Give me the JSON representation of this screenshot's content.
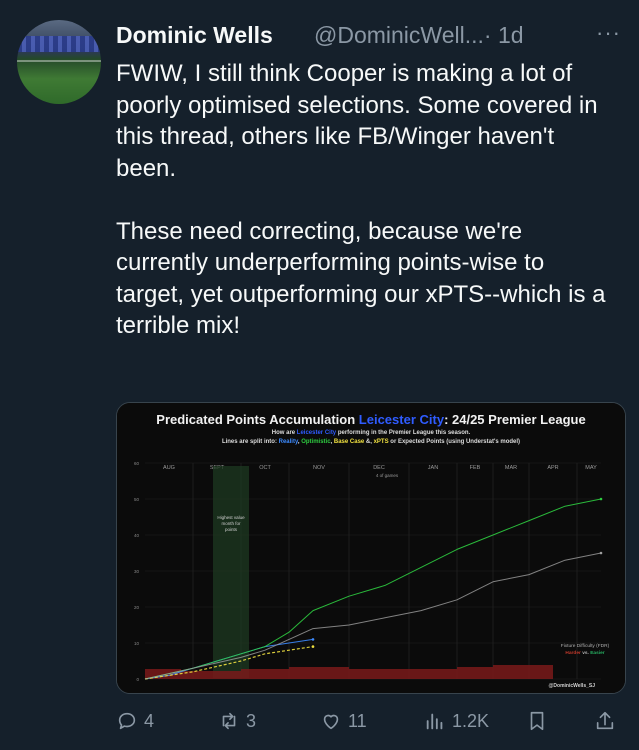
{
  "tweet": {
    "author_name": "Dominic Wells",
    "handle": "@DominicWell...",
    "time": "· 1d",
    "more": "···",
    "paragraph1": "FWIW, I still think Cooper is making a lot of poorly optimised selections. Some covered in this thread, others like FB/Winger haven't been.",
    "paragraph2": "These need correcting, because we're currently underperforming points-wise to target, yet outperforming our xPTS--which is a terrible mix!"
  },
  "chart": {
    "title_part1": "Predicated Points Accumulation ",
    "title_club": "Leicester City",
    "title_part2": ": 24/25 Premier League",
    "subtitle1_a": "How are ",
    "subtitle1_club": "Leicester City",
    "subtitle1_b": " performing in the Premier League this season.",
    "subtitle2_a": "Lines are split into: ",
    "subtitle2_reality": "Reality",
    "subtitle2_comma1": ", ",
    "subtitle2_optimistic": "Optimistic",
    "subtitle2_comma2": ", ",
    "subtitle2_base": "Base Case",
    "subtitle2_and": " &, ",
    "subtitle2_xpts": "xPTS",
    "subtitle2_end": " or Expected Points (using Understat's model)",
    "months": [
      "AUG",
      "SEPT",
      "OCT",
      "NOV",
      "DEC",
      "JAN",
      "FEB",
      "MAR",
      "APR",
      "MAY"
    ],
    "jan_note": "4 of games",
    "highlight_note": "Highest value month for points",
    "fdr_label": "Fixture Difficulty (FDR)",
    "fdr_harder": "Harder",
    "fdr_vs": " vs. ",
    "fdr_easier": "Easier",
    "credit": "@DominicWells_SJ",
    "colors": {
      "reality": "#3d8bff",
      "optimistic": "#2ecc40",
      "base": "#f0e040",
      "xpts": "#a0a0a0",
      "club": "#2f5cff",
      "harder": "#c0392b",
      "easier": "#27ae60"
    }
  },
  "chart_data": {
    "type": "line",
    "title": "Predicated Points Accumulation Leicester City: 24/25 Premier League",
    "xlabel": "",
    "ylabel": "",
    "ylim": [
      0,
      60
    ],
    "yticks": [
      0,
      10,
      20,
      30,
      40,
      50,
      60
    ],
    "x_categories": [
      "AUG",
      "SEPT",
      "OCT",
      "NOV",
      "DEC",
      "JAN",
      "FEB",
      "MAR",
      "APR",
      "MAY"
    ],
    "x_range": [
      0,
      38
    ],
    "series": [
      {
        "name": "Reality",
        "color": "#3d8bff",
        "x": [
          0,
          2,
          4,
          6,
          8,
          10,
          12,
          14
        ],
        "y": [
          0,
          1,
          3,
          5,
          7,
          9,
          10,
          11
        ]
      },
      {
        "name": "Optimistic",
        "color": "#2ecc40",
        "x": [
          0,
          4,
          8,
          10,
          12,
          14,
          17,
          20,
          23,
          26,
          29,
          32,
          35,
          38
        ],
        "y": [
          0,
          3,
          7,
          9,
          13,
          19,
          23,
          26,
          31,
          36,
          40,
          44,
          48,
          50
        ]
      },
      {
        "name": "Base Case",
        "color": "#f0e040",
        "x": [
          0,
          4,
          8,
          10,
          12,
          14
        ],
        "y": [
          0,
          2,
          5,
          7,
          8,
          9
        ]
      },
      {
        "name": "xPTS",
        "color": "#a0a0a0",
        "x": [
          0,
          4,
          8,
          10,
          12,
          14,
          17,
          20,
          23,
          26,
          29,
          32,
          35,
          38
        ],
        "y": [
          0,
          3,
          6,
          8,
          11,
          14,
          15,
          17,
          19,
          22,
          27,
          29,
          33,
          35
        ]
      }
    ],
    "fdr_bars": [
      {
        "from": 0,
        "to": 3,
        "level": 3
      },
      {
        "from": 3,
        "to": 8,
        "level": 2
      },
      {
        "from": 8,
        "to": 12,
        "level": 3
      },
      {
        "from": 12,
        "to": 17,
        "level": 4
      },
      {
        "from": 17,
        "to": 22,
        "level": 3
      },
      {
        "from": 22,
        "to": 26,
        "level": 3
      },
      {
        "from": 26,
        "to": 29,
        "level": 4
      },
      {
        "from": 29,
        "to": 34,
        "level": 5
      }
    ],
    "grid": true
  },
  "actions": {
    "replies": "4",
    "reposts": "3",
    "likes": "11",
    "views": "1.2K"
  }
}
